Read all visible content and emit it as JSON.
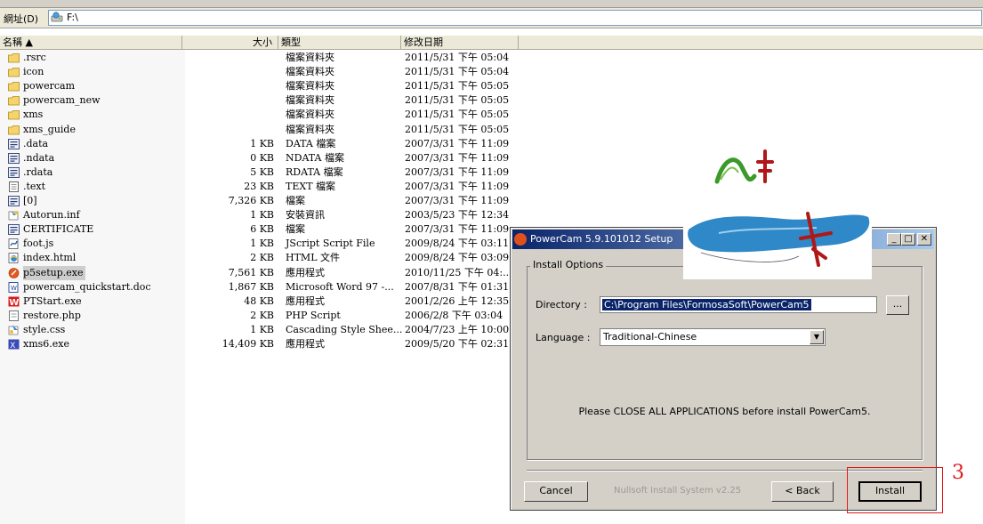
{
  "address": {
    "label": "網址(D)",
    "path": "F:\\"
  },
  "columns": {
    "name": "名稱 ▲",
    "size": "大小",
    "type": "類型",
    "date": "修改日期"
  },
  "files": [
    {
      "name": ".rsrc",
      "size": "",
      "type": "檔案資料夾",
      "date": "2011/5/31 下午 05:04",
      "icon": "folder-icon"
    },
    {
      "name": "icon",
      "size": "",
      "type": "檔案資料夾",
      "date": "2011/5/31 下午 05:04",
      "icon": "folder-icon"
    },
    {
      "name": "powercam",
      "size": "",
      "type": "檔案資料夾",
      "date": "2011/5/31 下午 05:05",
      "icon": "folder-icon"
    },
    {
      "name": "powercam_new",
      "size": "",
      "type": "檔案資料夾",
      "date": "2011/5/31 下午 05:05",
      "icon": "folder-icon"
    },
    {
      "name": "xms",
      "size": "",
      "type": "檔案資料夾",
      "date": "2011/5/31 下午 05:05",
      "icon": "folder-icon"
    },
    {
      "name": "xms_guide",
      "size": "",
      "type": "檔案資料夾",
      "date": "2011/5/31 下午 05:05",
      "icon": "folder-icon"
    },
    {
      "name": ".data",
      "size": "1 KB",
      "type": "DATA 檔案",
      "date": "2007/3/31 下午 11:09",
      "icon": "data-file-icon"
    },
    {
      "name": ".ndata",
      "size": "0 KB",
      "type": "NDATA 檔案",
      "date": "2007/3/31 下午 11:09",
      "icon": "data-file-icon"
    },
    {
      "name": ".rdata",
      "size": "5 KB",
      "type": "RDATA 檔案",
      "date": "2007/3/31 下午 11:09",
      "icon": "data-file-icon"
    },
    {
      "name": ".text",
      "size": "23 KB",
      "type": "TEXT 檔案",
      "date": "2007/3/31 下午 11:09",
      "icon": "text-file-icon"
    },
    {
      "name": "[0]",
      "size": "7,326 KB",
      "type": "檔案",
      "date": "2007/3/31 下午 11:09",
      "icon": "data-file-icon"
    },
    {
      "name": "Autorun.inf",
      "size": "1 KB",
      "type": "安裝資訊",
      "date": "2003/5/23 下午 12:34",
      "icon": "inf-file-icon"
    },
    {
      "name": "CERTIFICATE",
      "size": "6 KB",
      "type": "檔案",
      "date": "2007/3/31 下午 11:09",
      "icon": "data-file-icon"
    },
    {
      "name": "foot.js",
      "size": "1 KB",
      "type": "JScript Script File",
      "date": "2009/8/24 下午 03:11",
      "icon": "script-file-icon"
    },
    {
      "name": "index.html",
      "size": "2 KB",
      "type": "HTML 文件",
      "date": "2009/8/24 下午 03:09",
      "icon": "html-file-icon"
    },
    {
      "name": "p5setup.exe",
      "size": "7,561 KB",
      "type": "應用程式",
      "date": "2010/11/25 下午 04:..",
      "icon": "setup-exe-icon",
      "selected": true
    },
    {
      "name": "powercam_quickstart.doc",
      "size": "1,867 KB",
      "type": "Microsoft Word 97 -...",
      "date": "2007/8/31 下午 01:31",
      "icon": "word-doc-icon"
    },
    {
      "name": "PTStart.exe",
      "size": "48 KB",
      "type": "應用程式",
      "date": "2001/2/26 上午 12:35",
      "icon": "w-exe-icon"
    },
    {
      "name": "restore.php",
      "size": "2 KB",
      "type": "PHP Script",
      "date": "2006/2/8 下午 03:04",
      "icon": "php-file-icon"
    },
    {
      "name": "style.css",
      "size": "1 KB",
      "type": "Cascading Style Shee...",
      "date": "2004/7/23 上午 10:00",
      "icon": "css-file-icon"
    },
    {
      "name": "xms6.exe",
      "size": "14,409 KB",
      "type": "應用程式",
      "date": "2009/5/20 下午 02:31",
      "icon": "x-exe-icon"
    }
  ],
  "dialog": {
    "title": "PowerCam 5.9.101012 Setup",
    "group_label": "Install Options",
    "directory_label": "Directory :",
    "directory_value": "C:\\Program Files\\FormosaSoft\\PowerCam5",
    "browse_label": "...",
    "language_label": "Language :",
    "language_value": "Traditional-Chinese",
    "note": "Please CLOSE ALL APPLICATIONS before install PowerCam5.",
    "cancel_label": "Cancel",
    "nullsoft_label": "Nullsoft Install System v2.25",
    "back_label": "< Back",
    "install_label": "Install"
  },
  "annotation": {
    "label": "3",
    "color": "#e01818"
  }
}
